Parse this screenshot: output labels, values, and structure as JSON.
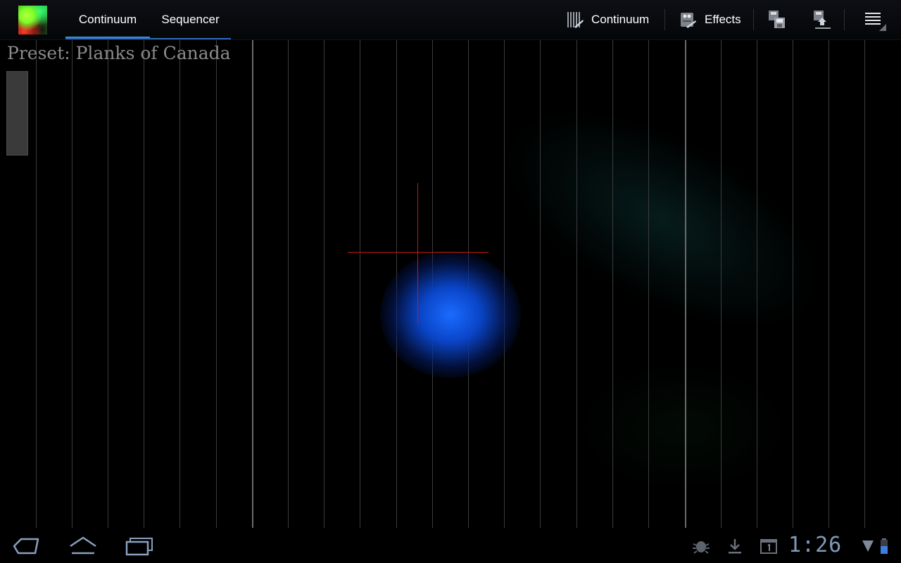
{
  "actionbar": {
    "tabs": [
      {
        "label": "Continuum",
        "active": true
      },
      {
        "label": "Sequencer",
        "active": false
      }
    ],
    "actions": {
      "instrument_label": "Continuum",
      "effects_label": "Effects"
    },
    "accent_color": "#3c8dde"
  },
  "playarea": {
    "preset_text": "Preset: Planks of Canada"
  },
  "sysbar": {
    "clock": "1:26"
  },
  "icons": {
    "app": "app-icon",
    "instrument": "instrument-icon",
    "effects": "effects-icon",
    "save": "save-icon",
    "load": "load-icon",
    "overflow": "overflow-menu-icon",
    "back": "back-icon",
    "home": "home-icon",
    "recents": "recent-apps-icon",
    "debug": "debug-icon",
    "download": "download-icon",
    "calendar": "calendar-icon",
    "wifi": "wifi-icon",
    "battery": "battery-icon"
  }
}
